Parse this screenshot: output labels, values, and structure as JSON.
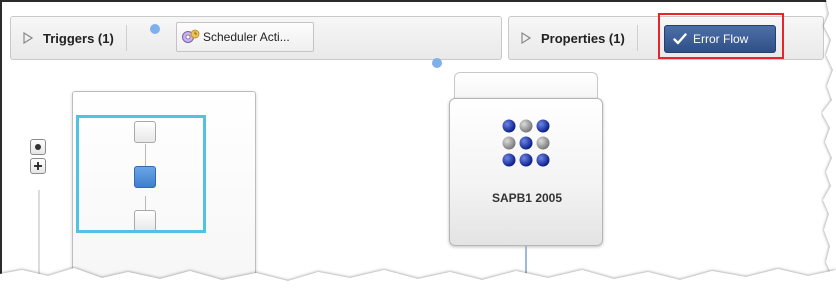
{
  "triggers_panel": {
    "title": "Triggers (1)",
    "scheduler_chip_label": "Scheduler Acti..."
  },
  "properties_panel": {
    "title": "Properties (1)",
    "error_flow_label": "Error Flow"
  },
  "node": {
    "label": "SAPB1 2005"
  },
  "colors": {
    "accent_blue": "#2f4f86",
    "highlight_red": "#e8252b",
    "minimap_viewport": "#52c2e0",
    "active_node": "#3f7fcb"
  }
}
